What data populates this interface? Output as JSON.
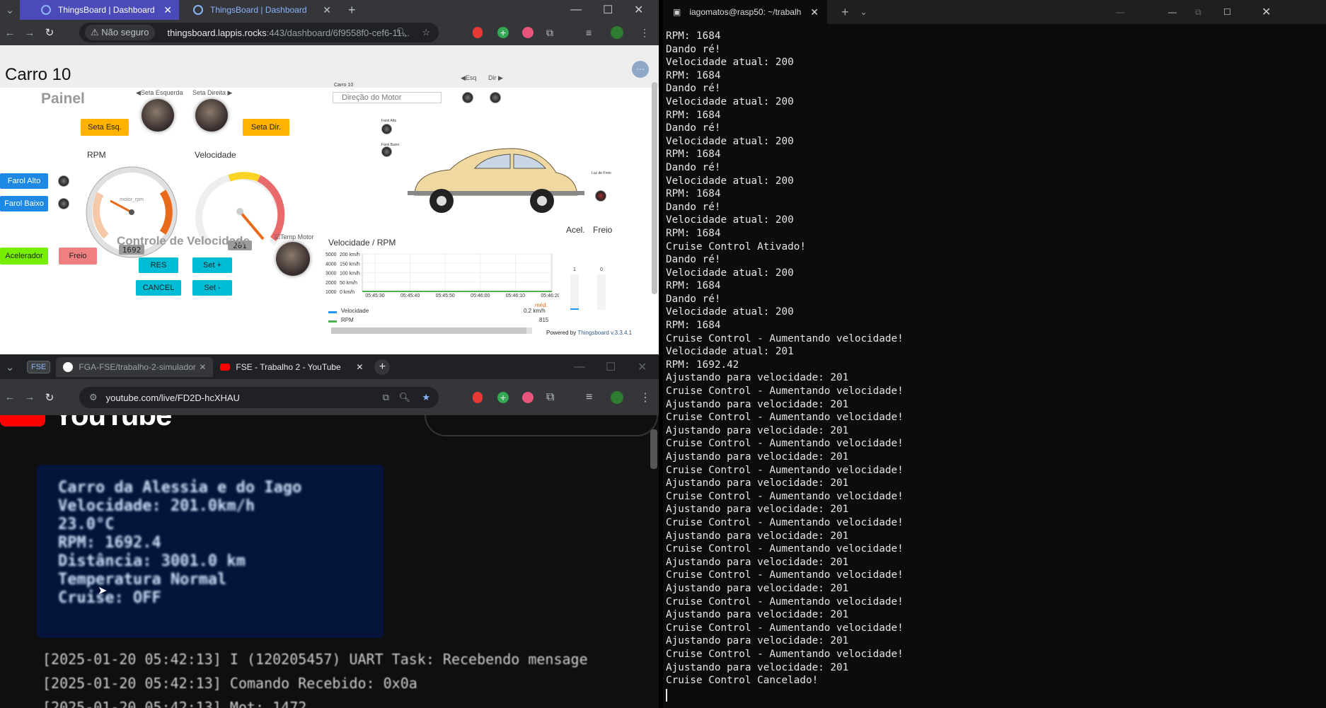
{
  "browser1": {
    "tabs": [
      {
        "label": "ThingsBoard | Dashboard",
        "active": true
      },
      {
        "label": "ThingsBoard | Dashboard",
        "active": false
      }
    ],
    "new_tab": "+",
    "not_secure": "Não seguro",
    "url_host": "thingsboard.lappis.rocks",
    "url_path": ":443/dashboard/6f9558f0-cef6-11..."
  },
  "dashboard": {
    "title": "Carro 10",
    "more_button": "···",
    "painel": "Painel",
    "seta_esquerda_label": "◀Seta Esquerda",
    "seta_direita_label": "Seta Direita ▶",
    "btn_seta_esq": "Seta Esq.",
    "btn_seta_dir": "Seta Dir.",
    "rpm_title": "RPM",
    "velocidade_title": "Velocidade",
    "farol_alto": "Farol Alto",
    "farol_baixo": "Farol Baixo",
    "rpm_value": "1692",
    "rpm_gauge_label": "motor_rpm",
    "rpm_ticks": [
      "0",
      "600",
      "1200",
      "1800",
      "2400",
      "3000",
      "3600",
      "4200",
      "4800",
      "5400",
      "6000"
    ],
    "vel_value": "201",
    "vel_ticks": [
      "0",
      "20",
      "40",
      "60",
      "80",
      "100",
      "120",
      "140",
      "160",
      "180",
      "200"
    ],
    "controle_velocidade": "Controle de Velocidade",
    "temp_motor_label": "☑Temp Motor",
    "acelerador": "Acelerador",
    "freio_btn": "Freio",
    "res": "RES",
    "set_plus": "Set +",
    "cancel": "CANCEL",
    "set_minus": "Set -",
    "carro_small": "Carro 10",
    "direcao_placeholder": "Direção do Motor",
    "esq_small": "◀Esq",
    "dir_small": "Dir ▶",
    "farol_small_1": "Farol Alto",
    "farol_small_2": "Farol Baixo",
    "luz_freio": "Luz de Freio",
    "acel": "Acel.",
    "freio": "Freio",
    "acel_val": "1",
    "freio_val": "0",
    "powered_by": "Powered by ",
    "tb_version": "Thingsboard v.3.3.4.1"
  },
  "chart_data": {
    "type": "line",
    "title": "Velocidade / RPM",
    "x": [
      "05:45:30",
      "05:45:40",
      "05:45:50",
      "05:46:00",
      "05:46:10",
      "05:46:20"
    ],
    "y_left_ticks": [
      "5000",
      "4000",
      "3000",
      "2000",
      "1000"
    ],
    "y_right_ticks": [
      "200 km/h",
      "150 km/h",
      "100 km/h",
      "50 km/h",
      "0 km/h"
    ],
    "legend_header": "méd.",
    "series": [
      {
        "name": "Velocidade",
        "color": "#2196f3",
        "avg": "0.2 km/h",
        "values": [
          0,
          0,
          0,
          0,
          0,
          0
        ]
      },
      {
        "name": "RPM",
        "color": "#4caf50",
        "avg": "815",
        "values": [
          800,
          800,
          800,
          800,
          800,
          800
        ]
      }
    ]
  },
  "terminal": {
    "tab_title": "iagomatos@rasp50: ~/trabalh",
    "lines": [
      "RPM: 1684",
      "Dando ré!",
      "Velocidade atual: 200",
      "RPM: 1684",
      "Dando ré!",
      "Velocidade atual: 200",
      "RPM: 1684",
      "Dando ré!",
      "Velocidade atual: 200",
      "RPM: 1684",
      "Dando ré!",
      "Velocidade atual: 200",
      "RPM: 1684",
      "Dando ré!",
      "Velocidade atual: 200",
      "RPM: 1684",
      "Cruise Control Ativado!",
      "Dando ré!",
      "Velocidade atual: 200",
      "RPM: 1684",
      "Dando ré!",
      "Velocidade atual: 200",
      "RPM: 1684",
      "Cruise Control - Aumentando velocidade!",
      "Velocidade atual: 201",
      "RPM: 1692.42",
      "Ajustando para velocidade: 201",
      "Cruise Control - Aumentando velocidade!",
      "Ajustando para velocidade: 201",
      "Cruise Control - Aumentando velocidade!",
      "Ajustando para velocidade: 201",
      "Cruise Control - Aumentando velocidade!",
      "Ajustando para velocidade: 201",
      "Cruise Control - Aumentando velocidade!",
      "Ajustando para velocidade: 201",
      "Cruise Control - Aumentando velocidade!",
      "Ajustando para velocidade: 201",
      "Cruise Control - Aumentando velocidade!",
      "Ajustando para velocidade: 201",
      "Cruise Control - Aumentando velocidade!",
      "Ajustando para velocidade: 201",
      "Cruise Control - Aumentando velocidade!",
      "Ajustando para velocidade: 201",
      "Cruise Control - Aumentando velocidade!",
      "Ajustando para velocidade: 201",
      "Cruise Control - Aumentando velocidade!",
      "Ajustando para velocidade: 201",
      "Cruise Control - Aumentando velocidade!",
      "Ajustando para velocidade: 201",
      "Cruise Control Cancelado!"
    ]
  },
  "browser2": {
    "group_label": "FSE",
    "tabs": [
      {
        "label": "FGA-FSE/trabalho-2-simulador",
        "active": true
      },
      {
        "label": "FSE - Trabalho 2 - YouTube",
        "active": false
      }
    ],
    "url": "youtube.com/live/FD2D-hcXHAU",
    "yt_logo": "YouTube",
    "video_lines": [
      "Carro da Alessia e do Iago",
      "Velocidade: 201.0km/h",
      "23.0°C",
      "RPM: 1692.4",
      "Distância: 3001.0 km",
      "Temperatura Normal",
      "Cruise: OFF"
    ],
    "log_lines": [
      "[2025-01-20 05:42:13] I (120205457) UART Task: Recebendo mensage",
      "[2025-01-20 05:42:13] Comando Recebido: 0x0a",
      "[2025-01-20 05:42:13] Mot: 1472"
    ]
  }
}
